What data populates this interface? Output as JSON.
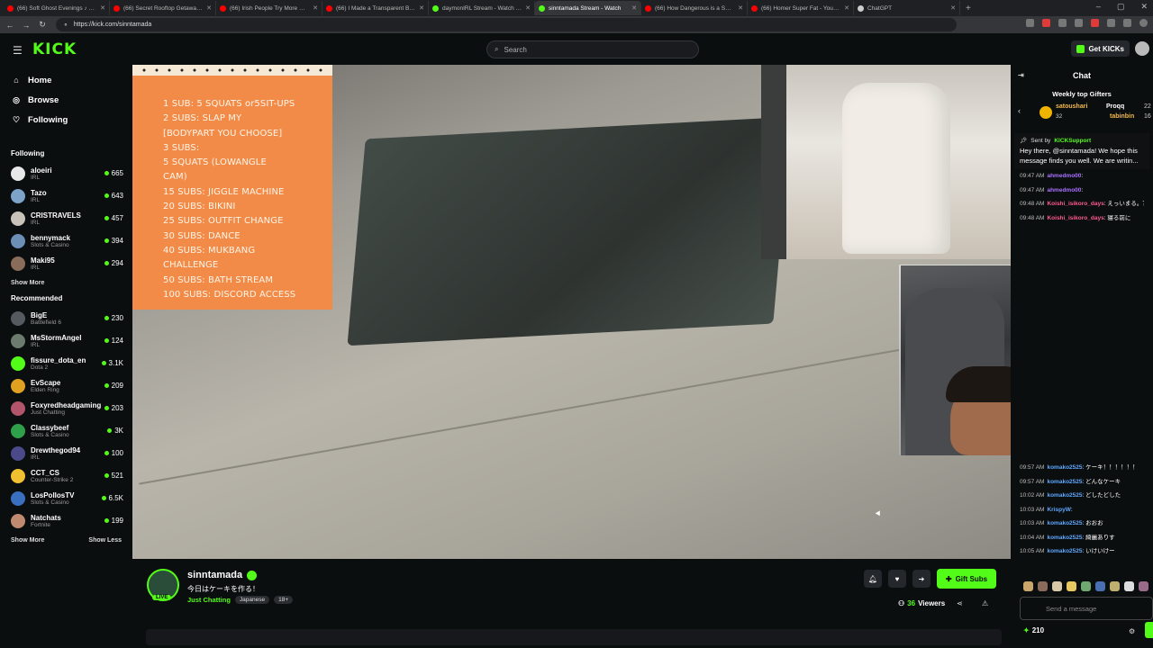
{
  "browser": {
    "tabs": [
      {
        "label": "(66) Soft Ghost Evenings ♪ Lofi I",
        "color": "#ff0000"
      },
      {
        "label": "(66) Secret Rooftop Getaway With",
        "color": "#ff0000"
      },
      {
        "label": "(66) Irish People Try More NEW F",
        "color": "#ff0000"
      },
      {
        "label": "(66) I Made a Transparent Boom",
        "color": "#ff0000"
      },
      {
        "label": "daymonIRL Stream - Watch Live o",
        "color": "#53fc18"
      },
      {
        "label": "sinntamada Stream - Watch",
        "color": "#53fc18"
      },
      {
        "label": "(66) How Dangerous is a Supers",
        "color": "#ff0000"
      },
      {
        "label": "(66) Homer Super Fat - YouTube",
        "color": "#ff0000"
      },
      {
        "label": "ChatGPT",
        "color": "#cccccc"
      }
    ],
    "url": "https://kick.com/sinntamada"
  },
  "header": {
    "logo": "KICK",
    "search_placeholder": "Search",
    "get_kicks": "Get KICKs"
  },
  "sidebar": {
    "nav": [
      {
        "label": "Home",
        "icon": "home-icon"
      },
      {
        "label": "Browse",
        "icon": "compass-icon"
      },
      {
        "label": "Following",
        "icon": "heart-icon"
      }
    ],
    "following_title": "Following",
    "following": [
      {
        "name": "aloeiri",
        "cat": "IRL",
        "viewers": "665",
        "color": "#e8e8e8"
      },
      {
        "name": "Tazo",
        "cat": "IRL",
        "viewers": "643",
        "color": "#7da3c9"
      },
      {
        "name": "CRISTRAVELS",
        "cat": "IRL",
        "viewers": "457",
        "color": "#c9c2b8"
      },
      {
        "name": "bennymack",
        "cat": "Slots & Casino",
        "viewers": "394",
        "color": "#6b8fb5"
      },
      {
        "name": "Maki95",
        "cat": "IRL",
        "viewers": "294",
        "color": "#8a6c5a"
      }
    ],
    "show_more": "Show More",
    "recommended_title": "Recommended",
    "recommended": [
      {
        "name": "BigE",
        "cat": "Battlefield 6",
        "viewers": "230",
        "color": "#555a60"
      },
      {
        "name": "MsStormAngel",
        "cat": "IRL",
        "viewers": "124",
        "color": "#6b7b6e"
      },
      {
        "name": "fissure_dota_en",
        "cat": "Dota 2",
        "viewers": "3.1K",
        "color": "#53fc18"
      },
      {
        "name": "EvScape",
        "cat": "Elden Ring",
        "viewers": "209",
        "color": "#e0a020"
      },
      {
        "name": "Foxyredheadgaming",
        "cat": "Just Chatting",
        "viewers": "203",
        "color": "#b0556a"
      },
      {
        "name": "Classybeef",
        "cat": "Slots & Casino",
        "viewers": "3K",
        "color": "#2fa04a"
      },
      {
        "name": "Drewthegod94",
        "cat": "IRL",
        "viewers": "100",
        "color": "#4a4a8a"
      },
      {
        "name": "CCT_CS",
        "cat": "Counter-Strike 2",
        "viewers": "521",
        "color": "#f0c030"
      },
      {
        "name": "LosPollosTV",
        "cat": "Slots & Casino",
        "viewers": "6.5K",
        "color": "#3a6fc0"
      },
      {
        "name": "Natchats",
        "cat": "Fortnite",
        "viewers": "199",
        "color": "#c08a70"
      }
    ],
    "show_more_2": "Show More",
    "show_less": "Show Less"
  },
  "overlay": {
    "lines": [
      "1 SUB: 5 SQUATS or5SIT-UPS",
      "2 SUBS: SLAP MY",
      "[BODYPART YOU CHOOSE]",
      "3 SUBS:",
      "5    SQUATS    (LOWANGLE",
      "CAM)",
      "15 SUBS: JIGGLE MACHINE",
      "20 SUBS: BIKINI",
      "25 SUBS: OUTFIT CHANGE",
      "30 SUBS: DANCE",
      "40 SUBS: MUKBANG",
      "CHALLENGE",
      "50 SUBS: BATH STREAM",
      "100 SUBS: DISCORD ACCESS"
    ]
  },
  "stream": {
    "channel": "sinntamada",
    "live": "LIVE",
    "title": "今日はケーキを作る！",
    "category": "Just Chatting",
    "tags": [
      "Japanese",
      "18+"
    ],
    "gift_subs": "Gift Subs",
    "viewers_count": "36",
    "viewers_label": "Viewers"
  },
  "chat": {
    "title": "Chat",
    "gifters_title": "Weekly top Gifters",
    "gifter1": "satoushari",
    "gifter1_count": "32",
    "gifter2": "Proqq",
    "gifter2_count": "22",
    "gifter3": "tabinbin",
    "gifter3_count": "16",
    "pinned_by_label": "Sent by",
    "pinned_by": "KICKSupport",
    "pinned_msg": "Hey there, @sinntamada! We hope this message finds you well. We are writin...",
    "messages_top": [
      {
        "time": "09:47 AM",
        "user": "ahmedmo00",
        "cls": "u1",
        "text": ":"
      },
      {
        "time": "09:47 AM",
        "user": "ahmedmo00",
        "cls": "u1",
        "text": ":"
      },
      {
        "time": "09:48 AM",
        "user": "Koishi_isikoro_days",
        "cls": "u2",
        "text": ": えっいまる。？"
      },
      {
        "time": "09:48 AM",
        "user": "Koishi_isikoro_days",
        "cls": "u2",
        "text": ": 寝る前に"
      }
    ],
    "messages_bottom": [
      {
        "time": "09:57 AM",
        "user": "komako2525",
        "cls": "u3",
        "text": ": ケーキ！！！！！！"
      },
      {
        "time": "09:57 AM",
        "user": "komako2525",
        "cls": "u3",
        "text": ": どんなケーキ"
      },
      {
        "time": "10:02 AM",
        "user": "komako2525",
        "cls": "u3",
        "text": ": どしたどした"
      },
      {
        "time": "10:03 AM",
        "user": "KrispyW",
        "cls": "u3",
        "text": ":"
      },
      {
        "time": "10:03 AM",
        "user": "komako2525",
        "cls": "u3",
        "text": ": おおお"
      },
      {
        "time": "10:04 AM",
        "user": "komako2525",
        "cls": "u3",
        "text": ": 綺麗ありす"
      },
      {
        "time": "10:05 AM",
        "user": "komako2525",
        "cls": "u3",
        "text": ": いけいけー"
      }
    ],
    "send_placeholder": "Send a message",
    "points": "210"
  }
}
